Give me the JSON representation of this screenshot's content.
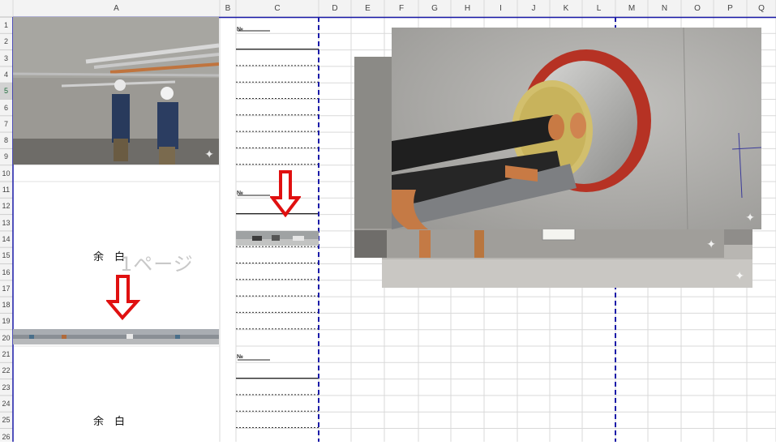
{
  "sheet": {
    "columns": [
      "A",
      "B",
      "C",
      "D",
      "E",
      "F",
      "G",
      "H",
      "I",
      "J",
      "K",
      "L",
      "M",
      "N",
      "O",
      "P",
      "Q"
    ],
    "rows": [
      "1",
      "2",
      "3",
      "4",
      "5",
      "6",
      "7",
      "8",
      "9",
      "10",
      "11",
      "12",
      "13",
      "14",
      "15",
      "16",
      "17",
      "18",
      "19",
      "20",
      "21",
      "22",
      "23",
      "24",
      "25",
      "26"
    ],
    "selected_row": "5"
  },
  "cells": {
    "number_label": "№",
    "blank_text": "余　白",
    "page_watermark": "1ページ"
  },
  "colors": {
    "grid": "#d9d9d9",
    "header_bg": "#f3f3f3",
    "page_break": "#1a1aa8",
    "arrow": "#e01010",
    "seal": "#b63224"
  },
  "icons": {
    "sparkle": "sparkle-icon",
    "arrow": "down-arrow-icon"
  },
  "photos": [
    {
      "subject": "workers installing ceiling pipes"
    },
    {
      "subject": "parking garage pipe corridor"
    },
    {
      "subject": "copper pipes through wall sleeve"
    }
  ]
}
